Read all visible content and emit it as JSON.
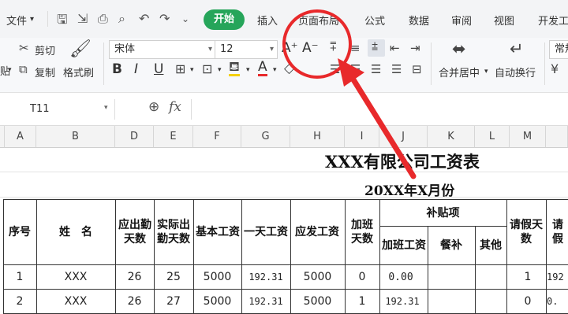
{
  "menu": {
    "file": "文件",
    "tabs": [
      "开始",
      "插入",
      "页面布局",
      "公式",
      "数据",
      "审阅",
      "视图",
      "开发工"
    ]
  },
  "ribbon": {
    "paste": "粘",
    "paste_short": "贴",
    "cut": "剪切",
    "copy": "复制",
    "format_painter": "格式刷",
    "font_name": "宋体",
    "font_size": "12",
    "bold": "B",
    "italic": "I",
    "underline": "U",
    "merge_center": "合并居中",
    "wrap_text": "自动换行",
    "number_format": "常规"
  },
  "formula_bar": {
    "cell_ref": "T11",
    "fx": "fx"
  },
  "columns": [
    "A",
    "B",
    "D",
    "E",
    "F",
    "G",
    "H",
    "I",
    "J",
    "K",
    "L",
    "M"
  ],
  "sheet": {
    "title": "XXX有限公司工资表",
    "subtitle": "20XX年X月份",
    "headers": {
      "seq": "序号",
      "name": "姓　名",
      "due_days": "应出勤天数",
      "actual_days": "实际出勤天数",
      "base_salary": "基本工资",
      "daily_wage": "一天工资",
      "gross_pay": "应发工资",
      "ot_days": "加班天数",
      "allowance": "补贴项",
      "ot_pay": "加班工资",
      "meal": "餐补",
      "other": "其他",
      "leave_days": "请假天数",
      "leave_deduct": "请假"
    },
    "rows": [
      {
        "seq": "1",
        "name": "XXX",
        "due": "26",
        "actual": "25",
        "base": "5000",
        "daily": "192.31",
        "gross": "5000",
        "ot_days": "0",
        "ot_pay": "0.00",
        "meal": "",
        "other": "",
        "leave": "1",
        "leave_deduct": "192"
      },
      {
        "seq": "2",
        "name": "XXX",
        "due": "26",
        "actual": "27",
        "base": "5000",
        "daily": "192.31",
        "gross": "5000",
        "ot_days": "1",
        "ot_pay": "192.31",
        "meal": "",
        "other": "",
        "leave": "0",
        "leave_deduct": "0."
      }
    ]
  }
}
